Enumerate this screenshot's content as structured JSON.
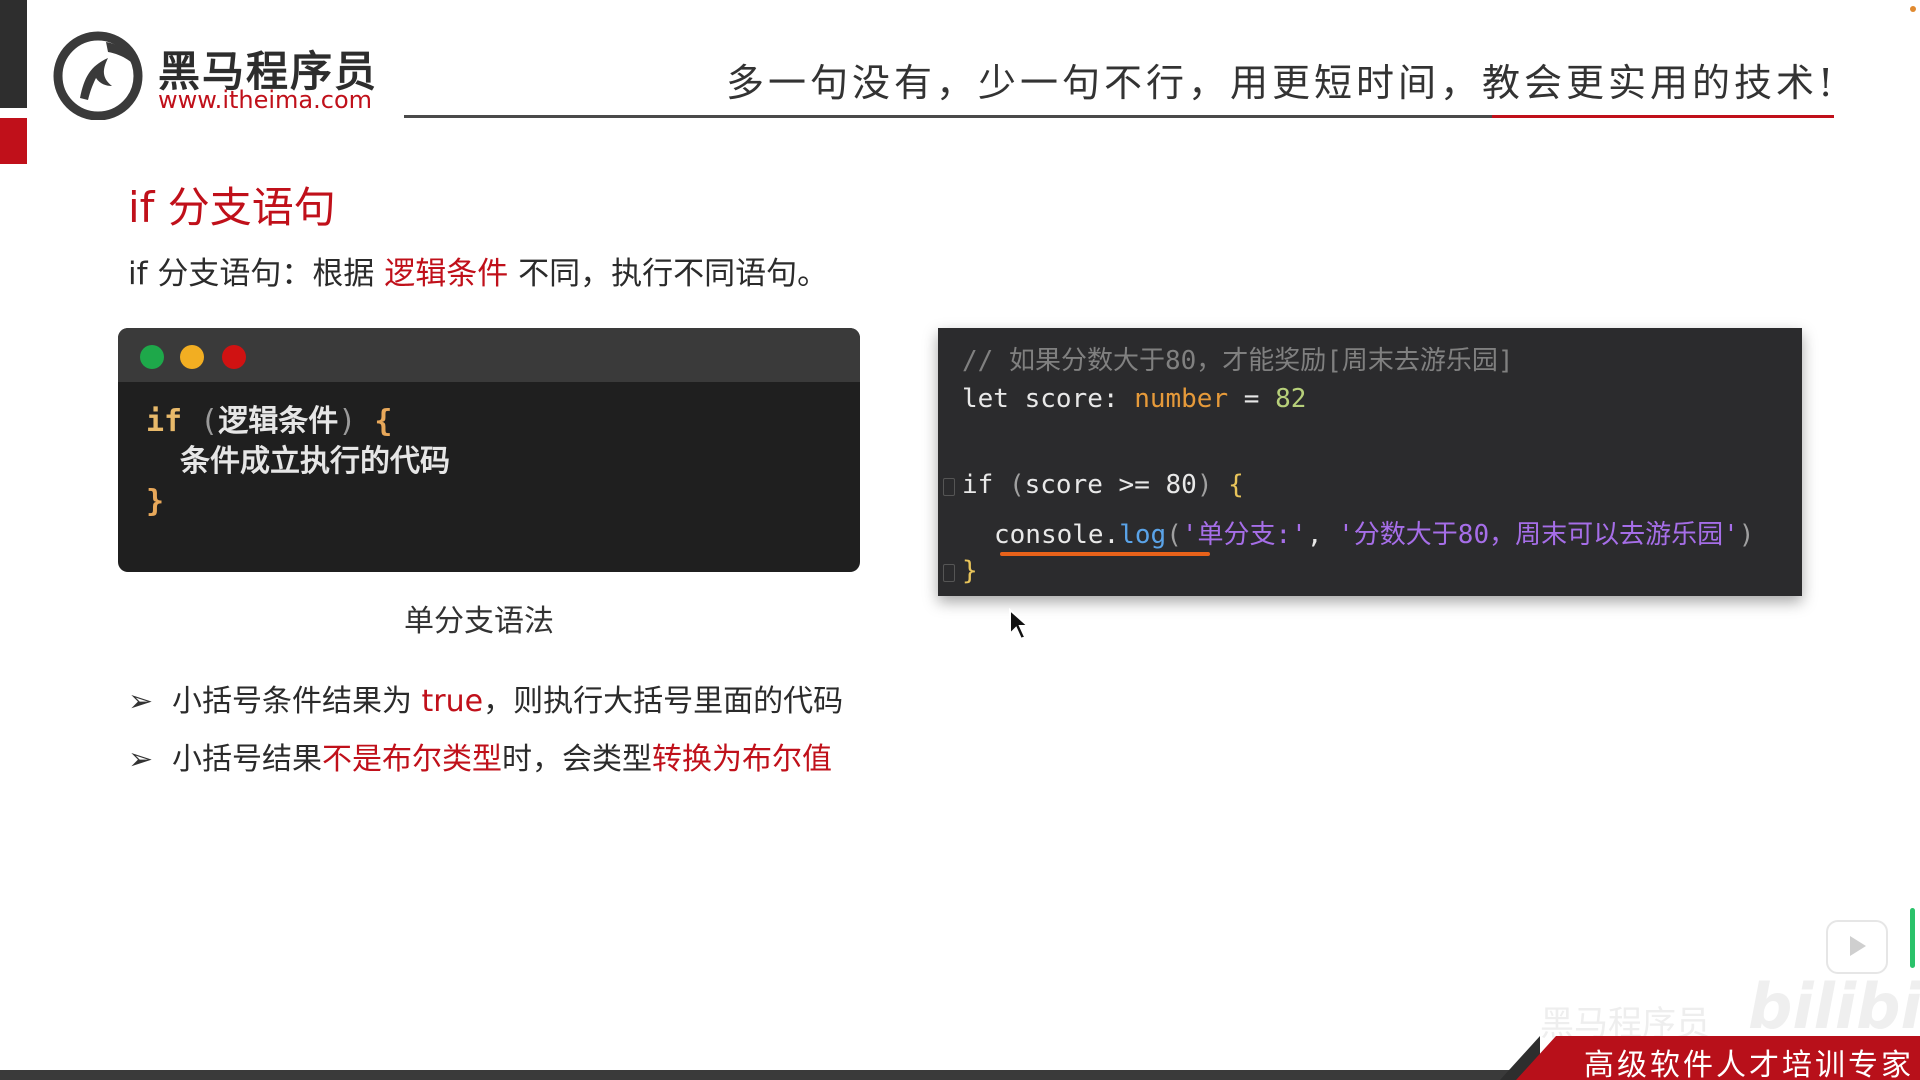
{
  "header": {
    "brand_name": "黑马程序员",
    "brand_url": "www.itheima.com",
    "slogan": "多一句没有，少一句不行，用更短时间，教会更实用的技术!"
  },
  "slide": {
    "title": "if 分支语句",
    "intro_prefix": "if 分支语句：根据 ",
    "intro_highlight": "逻辑条件",
    "intro_suffix": " 不同，执行不同语句。"
  },
  "syntax_card": {
    "line1_kw": "if",
    "line1_open_paren": " (",
    "line1_condition": "逻辑条件",
    "line1_close_paren": ")",
    "line1_brace": " {",
    "line2": "条件成立执行的代码",
    "line3_brace": "}",
    "caption": "单分支语法"
  },
  "bullets": [
    {
      "arrow": "➢",
      "prefix": "小括号条件结果为 ",
      "highlight": "true",
      "suffix": "，则执行大括号里面的代码"
    },
    {
      "arrow": "➢",
      "prefix": "小括号结果",
      "highlight1": "不是布尔类型",
      "middle": "时，会类型",
      "highlight2": "转换为布尔值"
    }
  ],
  "ide_code": {
    "comment": "// 如果分数大于80，才能奖励[周末去游乐园]",
    "l2_let": "let score: ",
    "l2_type": "number",
    "l2_eq": " = ",
    "l2_val": "82",
    "l4_if": "if ",
    "l4_open": "(",
    "l4_cond": "score >= 80",
    "l4_close": ")",
    "l4_brace": " {",
    "l5_obj": "console.",
    "l5_fn": "log",
    "l5_open": "(",
    "l5_str1": "'单分支:'",
    "l5_comma": ", ",
    "l5_str2": "'分数大于80，周末可以去游乐园'",
    "l5_close": ")",
    "l6_brace": "}"
  },
  "footer": {
    "badge": "高级软件人才培训专家",
    "watermark_left": "黑马程序员",
    "watermark_bili": "bilibili"
  },
  "colors": {
    "accent_red": "#c0101a",
    "dark": "#2e2e2e"
  }
}
